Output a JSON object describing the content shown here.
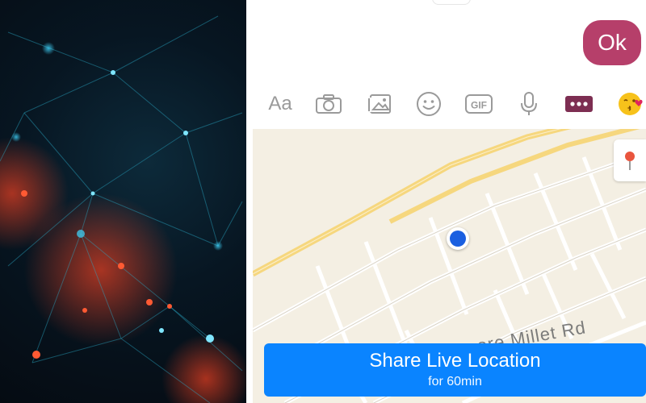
{
  "chat": {
    "message": "Ok"
  },
  "toolbar": {
    "text_label": "Aa",
    "items": [
      {
        "icon": "text-icon"
      },
      {
        "icon": "camera-icon"
      },
      {
        "icon": "photo-icon"
      },
      {
        "icon": "emoji-icon"
      },
      {
        "icon": "gif-icon"
      },
      {
        "icon": "microphone-icon"
      },
      {
        "icon": "more-icon"
      },
      {
        "icon": "kiss-emoji-icon"
      }
    ]
  },
  "map": {
    "street_label": "ore Millet Rd",
    "share": {
      "title": "Share Live Location",
      "subtitle": "for 60min"
    }
  },
  "colors": {
    "bubble": "#b63f6a",
    "share_button": "#0a84ff",
    "location_dot": "#1a5fe0",
    "more_button": "#7d2e52"
  }
}
